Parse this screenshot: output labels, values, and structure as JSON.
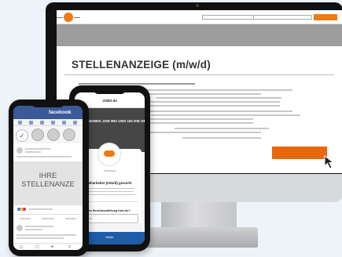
{
  "monitor": {
    "headline": "STELLENANZEIGE (m/w/d)"
  },
  "job_app": {
    "title": "JOBS.de",
    "banner_text": "FINDE DEINEN JOB BEI UNS UN DIE DENS",
    "company": "Company",
    "job_title": "Mitarbeiter (m/w/d) gesucht",
    "question": "Welche Berufsausbildung hast du?",
    "input_placeholder": "Antwort",
    "next_button": "Weiter"
  },
  "facebook": {
    "brand": "facebook",
    "ad_text": "IHRE\nSTELLENANZE"
  },
  "colors": {
    "accent_orange": "#e8670e",
    "facebook_blue": "#3b5998",
    "next_blue": "#1f5ca8"
  }
}
